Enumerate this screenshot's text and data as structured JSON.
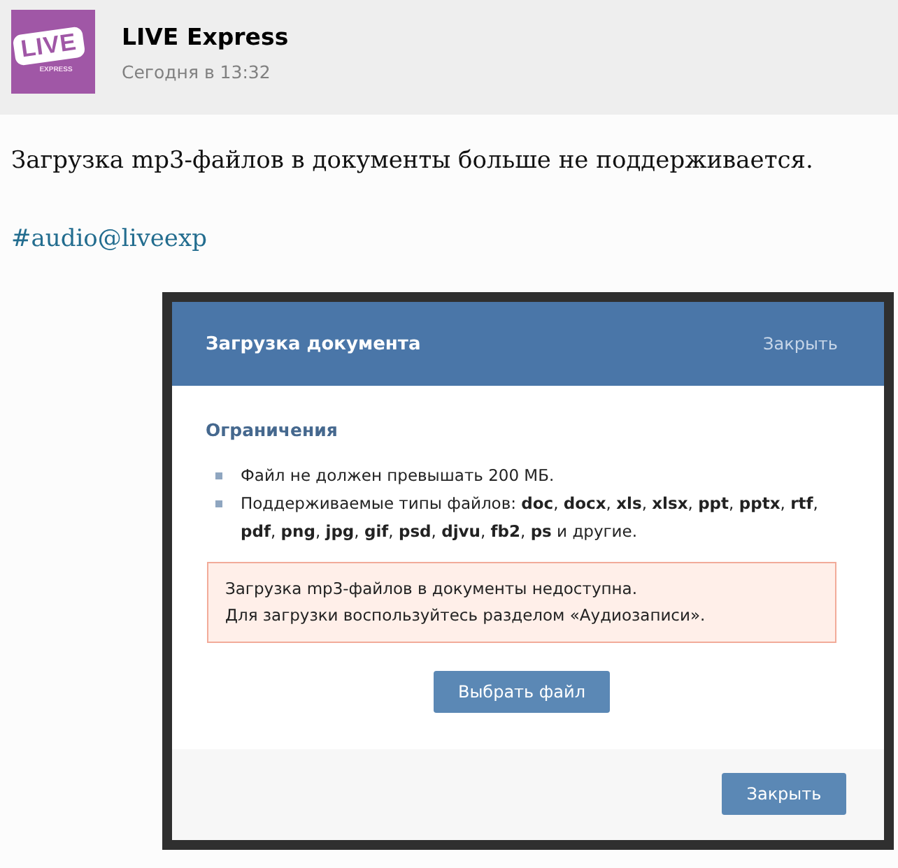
{
  "post": {
    "avatar": {
      "text": "LIVE",
      "subtext": "EXPRESS"
    },
    "author": "LIVE Express",
    "time": "Сегодня в 13:32",
    "text": "Загрузка mp3-файлов в документы больше не поддерживается.",
    "hashtag": "#audio@liveexp"
  },
  "screenshot": {
    "dialog": {
      "title": "Загрузка документа",
      "header_close": "Закрыть",
      "section_title": "Ограничения",
      "rules": [
        "Файл не должен превышать 200 МБ.",
        "Поддерживаемые типы файлов: **doc**, **docx**, **xls**, **xlsx**, **ppt**, **pptx**, **rtf**, **pdf**, **png**, **jpg**, **gif**, **psd**, **djvu**, **fb2**, **ps** и другие."
      ],
      "error_lines": [
        "Загрузка mp3-файлов в документы недоступна.",
        "Для загрузки воспользуйтесь разделом «Аудиозаписи»."
      ],
      "choose_button": "Выбрать файл",
      "close_button": "Закрыть"
    }
  }
}
